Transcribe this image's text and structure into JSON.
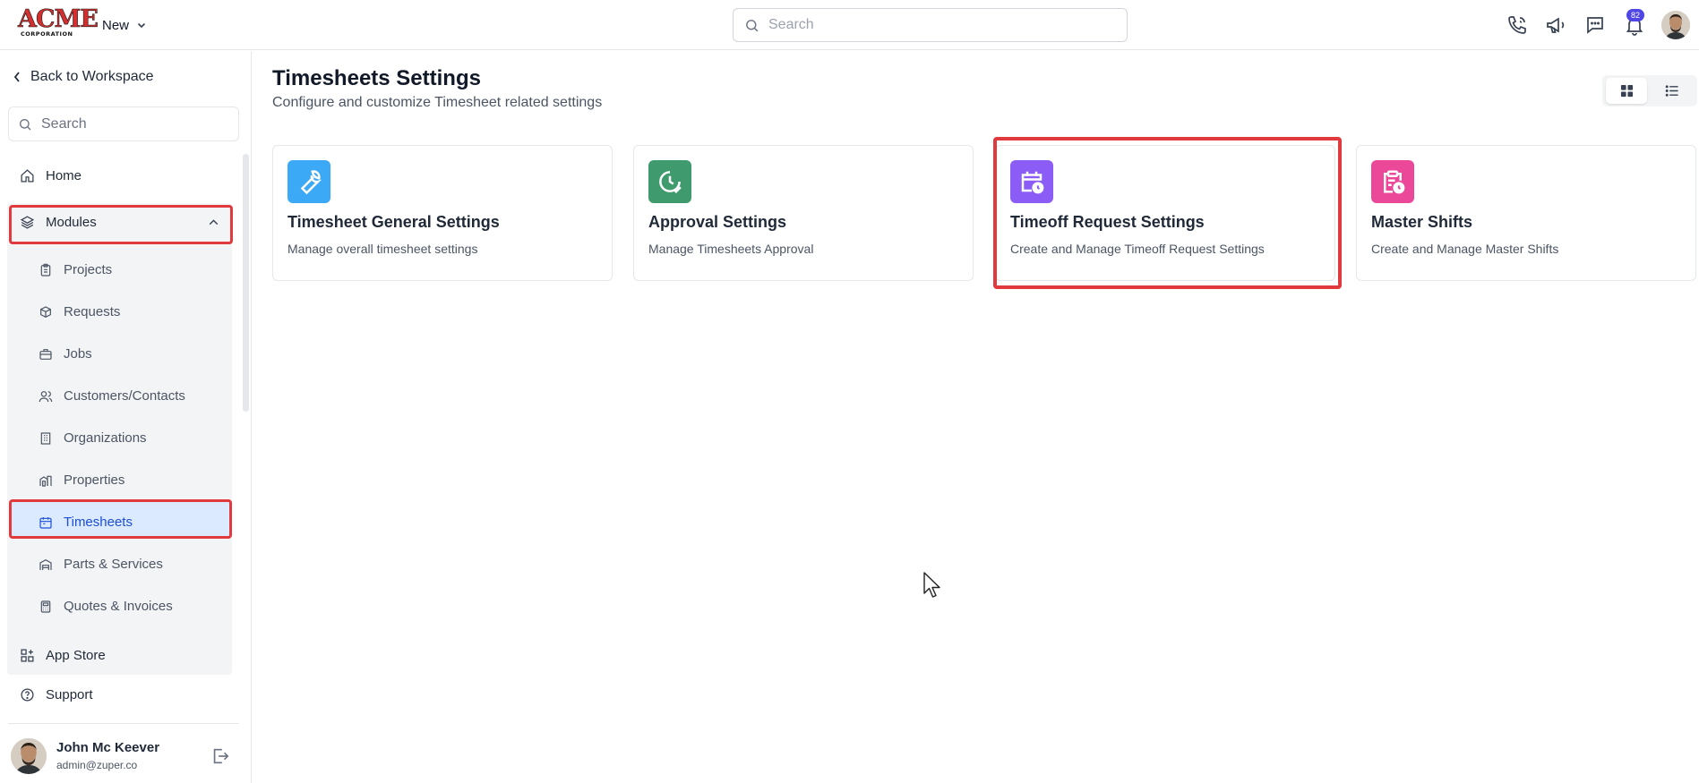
{
  "header": {
    "logo_text": "ACME",
    "logo_subtext": "CORPORATION",
    "new_label": "New",
    "search_placeholder": "Search",
    "notification_count": "82",
    "icons": [
      "phone-icon",
      "megaphone-icon",
      "chat-icon",
      "bell-icon"
    ]
  },
  "sidebar": {
    "back_label": "Back to Workspace",
    "search_placeholder": "Search",
    "home_label": "Home",
    "modules_label": "Modules",
    "modules": [
      {
        "label": "Projects",
        "icon": "clipboard-icon"
      },
      {
        "label": "Requests",
        "icon": "box-icon"
      },
      {
        "label": "Jobs",
        "icon": "briefcase-icon"
      },
      {
        "label": "Customers/Contacts",
        "icon": "users-icon"
      },
      {
        "label": "Organizations",
        "icon": "building-icon"
      },
      {
        "label": "Properties",
        "icon": "property-icon"
      },
      {
        "label": "Timesheets",
        "icon": "calendar-icon",
        "active": true
      },
      {
        "label": "Parts & Services",
        "icon": "warehouse-icon"
      },
      {
        "label": "Quotes & Invoices",
        "icon": "calculator-icon"
      }
    ],
    "app_store_label": "App Store",
    "support_label": "Support",
    "user": {
      "name": "John Mc Keever",
      "email": "admin@zuper.co"
    }
  },
  "main": {
    "title": "Timesheets Settings",
    "subtitle": "Configure and customize Timesheet related settings",
    "cards": [
      {
        "title": "Timesheet General Settings",
        "description": "Manage overall timesheet settings",
        "icon": "wrench-icon",
        "color": "#3ba9f5"
      },
      {
        "title": "Approval Settings",
        "description": "Manage Timesheets Approval",
        "icon": "clock-check-icon",
        "color": "#3f9b6e"
      },
      {
        "title": "Timeoff Request Settings",
        "description": "Create and Manage Timeoff Request Settings",
        "icon": "calendar-clock-icon",
        "color": "#8b5cf6"
      },
      {
        "title": "Master Shifts",
        "description": "Create and Manage Master Shifts",
        "icon": "clipboard-clock-icon",
        "color": "#ec4899"
      }
    ]
  },
  "colors": {
    "highlight": "#e03a3e",
    "active_bg": "#dbeafe",
    "badge": "#4f46e5"
  }
}
